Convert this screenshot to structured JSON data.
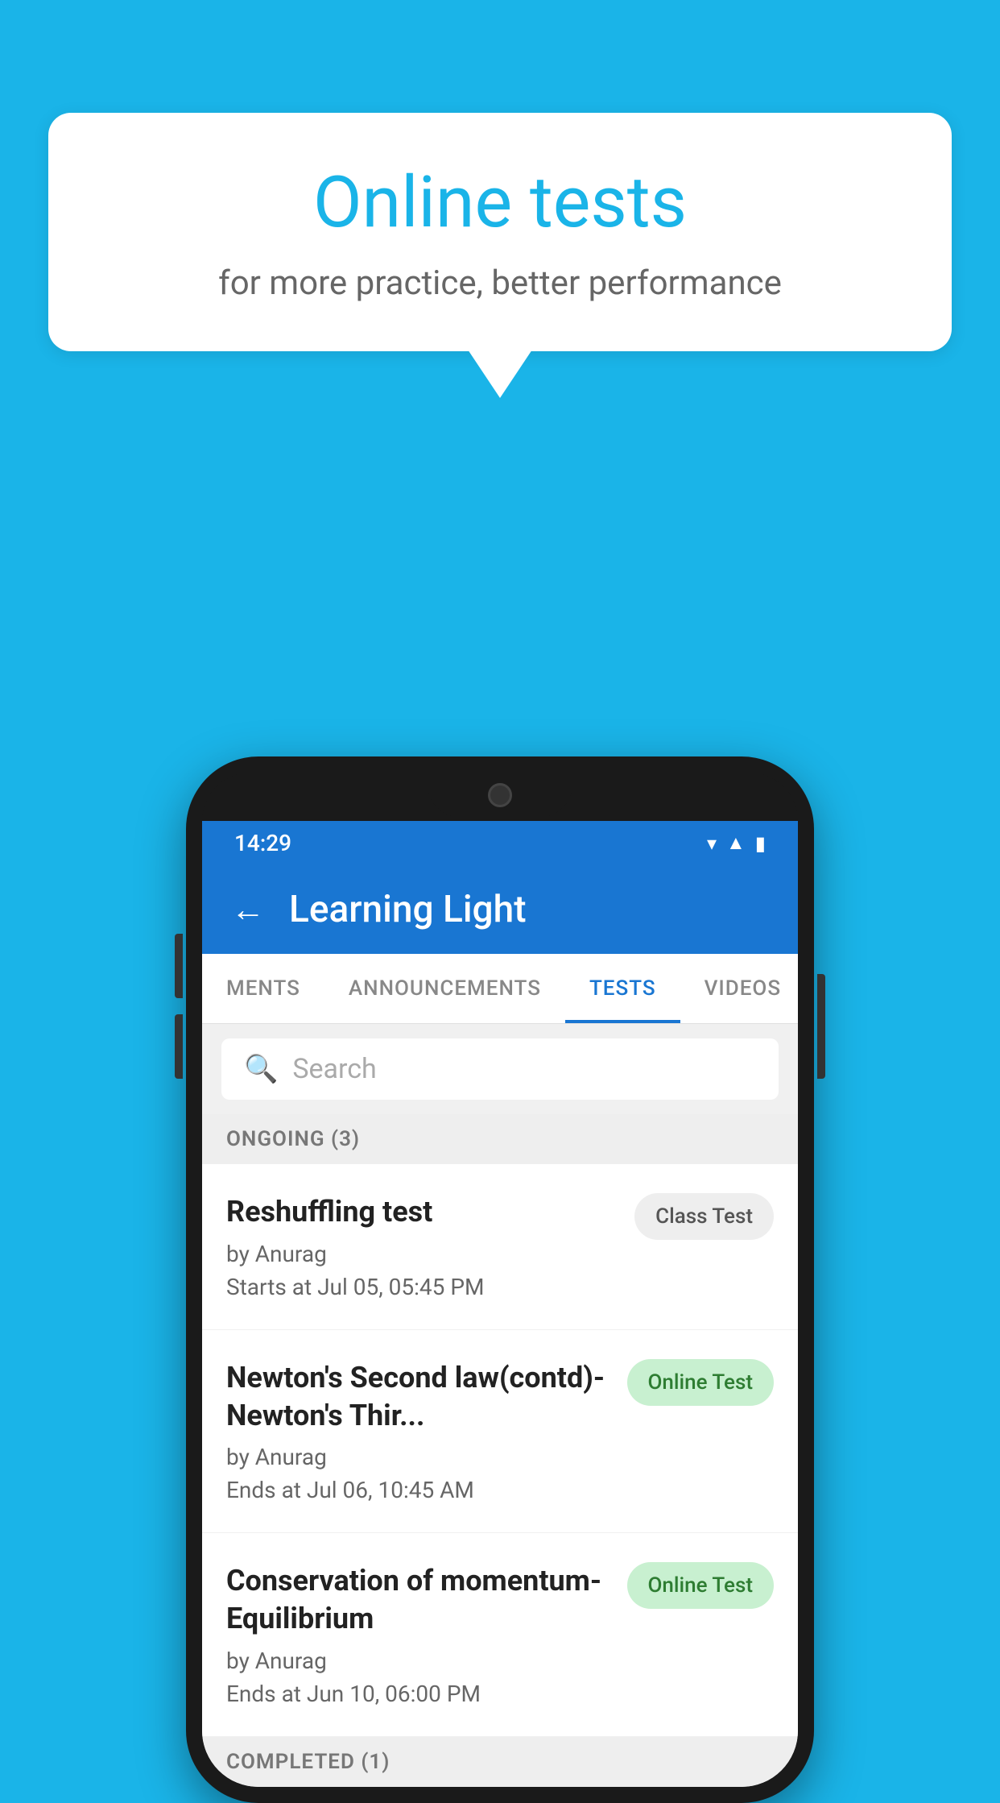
{
  "background": {
    "color": "#1ab4e8"
  },
  "speech_bubble": {
    "title": "Online tests",
    "subtitle": "for more practice, better performance"
  },
  "status_bar": {
    "time": "14:29",
    "wifi_icon": "▾",
    "signal_icon": "▾",
    "battery_icon": "▮"
  },
  "app_bar": {
    "back_label": "←",
    "title": "Learning Light"
  },
  "tabs": [
    {
      "label": "MENTS",
      "active": false
    },
    {
      "label": "ANNOUNCEMENTS",
      "active": false
    },
    {
      "label": "TESTS",
      "active": true
    },
    {
      "label": "VIDEOS",
      "active": false
    }
  ],
  "search": {
    "placeholder": "Search"
  },
  "sections": {
    "ongoing": {
      "header": "ONGOING (3)",
      "tests": [
        {
          "title": "Reshuffling test",
          "author": "by Anurag",
          "time_label": "Starts at",
          "time": "Jul 05, 05:45 PM",
          "badge": "Class Test",
          "badge_type": "class"
        },
        {
          "title": "Newton's Second law(contd)-Newton's Thir...",
          "author": "by Anurag",
          "time_label": "Ends at",
          "time": "Jul 06, 10:45 AM",
          "badge": "Online Test",
          "badge_type": "online"
        },
        {
          "title": "Conservation of momentum-Equilibrium",
          "author": "by Anurag",
          "time_label": "Ends at",
          "time": "Jun 10, 06:00 PM",
          "badge": "Online Test",
          "badge_type": "online"
        }
      ]
    },
    "completed": {
      "header": "COMPLETED (1)"
    }
  }
}
